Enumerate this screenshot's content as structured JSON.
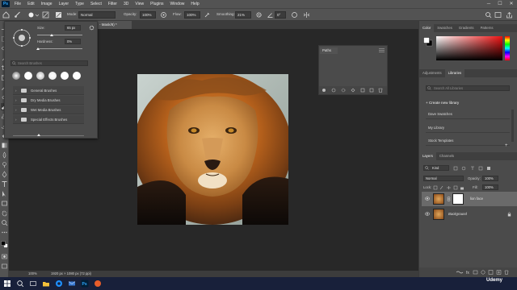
{
  "menubar": {
    "app_badge": "Ps",
    "items": [
      "File",
      "Edit",
      "Image",
      "Layer",
      "Type",
      "Select",
      "Filter",
      "3D",
      "View",
      "Plugins",
      "Window",
      "Help"
    ]
  },
  "options": {
    "mode_label": "Mode:",
    "mode_value": "Normal",
    "opacity_label": "Opacity:",
    "opacity_value": "100%",
    "flow_label": "Flow:",
    "flow_value": "100%",
    "smoothing_label": "Smoothing:",
    "smoothing_value": "21%",
    "angle_value": "0°"
  },
  "document": {
    "tab_title": "- Mask/8) *",
    "status_zoom": "100%",
    "status_size": "1920 px × 1080 px (72 ppi)"
  },
  "brush_panel": {
    "size_label": "Size:",
    "size_value": "65 px",
    "hardness_label": "Hardness:",
    "hardness_value": "0%",
    "search_placeholder": "Search Brushes",
    "groups": [
      {
        "label": "General Brushes"
      },
      {
        "label": "Dry Media Brushes"
      },
      {
        "label": "Wet Media Brushes"
      },
      {
        "label": "Special Effects Brushes"
      }
    ]
  },
  "paths_panel": {
    "title": "Paths"
  },
  "color_panel": {
    "tabs": [
      "Color",
      "Swatches",
      "Gradients",
      "Patterns"
    ]
  },
  "libraries_panel": {
    "tabs": [
      "Adjustments",
      "Libraries"
    ],
    "search_placeholder": "Search All Libraries",
    "create_label": "+ Create new library",
    "libraries": [
      {
        "name": "Dave Swatches"
      },
      {
        "name": "My Library"
      },
      {
        "name": "Stock Templates"
      }
    ]
  },
  "layers_panel": {
    "tabs": [
      "Layers",
      "Channels"
    ],
    "kind_value": "Kind",
    "blend_value": "Normal",
    "opacity_label": "Opacity:",
    "opacity_value": "100%",
    "lock_label": "Lock:",
    "fill_label": "Fill:",
    "fill_value": "100%",
    "layers": [
      {
        "name": "lion face",
        "selected": true
      },
      {
        "name": "Background",
        "selected": false
      }
    ]
  },
  "watermark": "Udemy",
  "colors": {
    "ui_panel": "#4b4b4b",
    "canvas_bg": "#282828",
    "accent": "#31a8ff",
    "taskbar": "#18203a"
  }
}
